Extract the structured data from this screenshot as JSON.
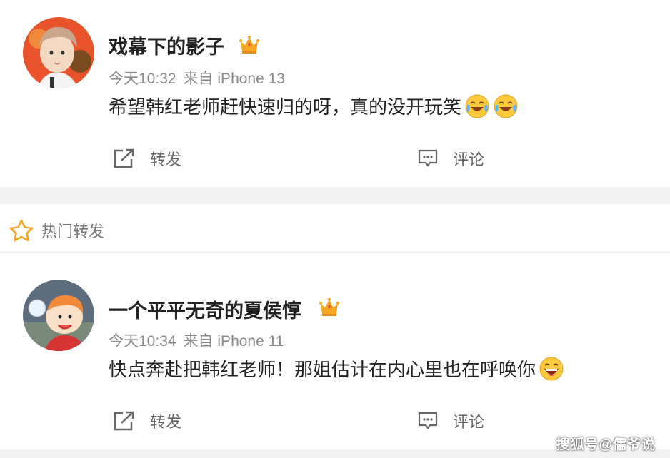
{
  "posts": [
    {
      "username": "戏幕下的影子",
      "badge_icon": "crown-level-badge",
      "time": "今天10:32",
      "source": "来自 iPhone 13",
      "content": "希望韩红老师赶快速归的呀，真的没开玩笑",
      "emojis": [
        "laugh-cry-emoji",
        "laugh-cry-emoji"
      ],
      "repost_label": "转发",
      "comment_label": "评论"
    },
    {
      "username": "一个平平无奇的夏侯惇",
      "badge_icon": "crown-level-badge",
      "time": "今天10:34",
      "source": "来自 iPhone 11",
      "content": "快点奔赴把韩红老师！那姐估计在内心里也在呼唤你",
      "emojis": [
        "grin-emoji"
      ],
      "repost_label": "转发",
      "comment_label": "评论"
    }
  ],
  "section": {
    "label": "热门转发",
    "icon": "star-outline-icon"
  },
  "watermark": "搜狐号@儒爷说",
  "colors": {
    "divider": "#f2f2f2",
    "meta": "#8a8a8a",
    "crown": "#f5a623"
  }
}
